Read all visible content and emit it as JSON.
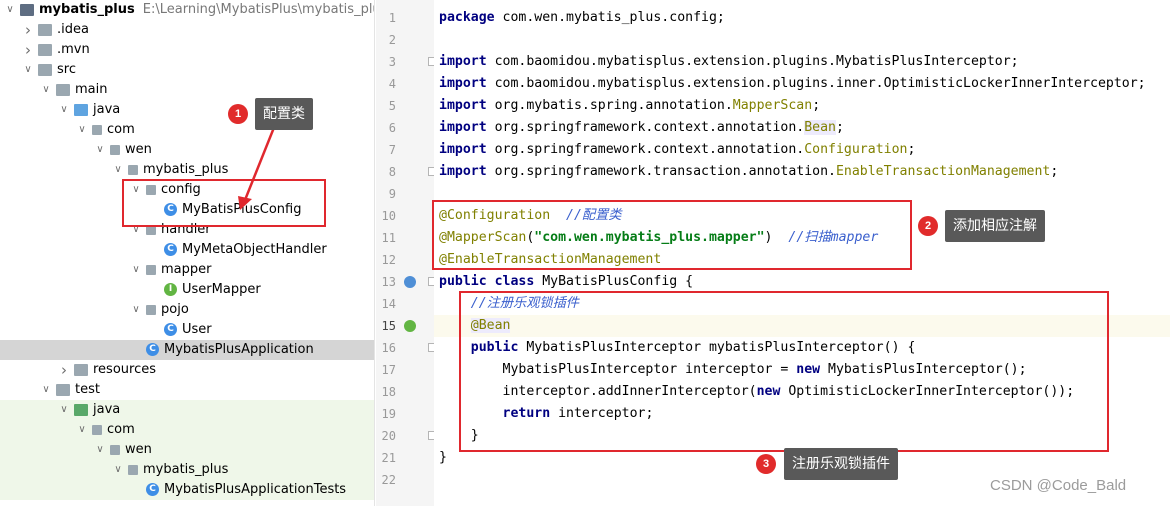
{
  "tree": [
    {
      "depth": 0,
      "open": true,
      "icon": "module",
      "label": "mybatis_plus",
      "path": "E:\\Learning\\MybatisPlus\\mybatis_plus",
      "bold": true
    },
    {
      "depth": 1,
      "open": false,
      "icon": "folder",
      "label": ".idea"
    },
    {
      "depth": 1,
      "open": false,
      "icon": "folder",
      "label": ".mvn"
    },
    {
      "depth": 1,
      "open": true,
      "icon": "folder",
      "label": "src"
    },
    {
      "depth": 2,
      "open": true,
      "icon": "folder",
      "label": "main"
    },
    {
      "depth": 3,
      "open": true,
      "icon": "folder-blue",
      "label": "java"
    },
    {
      "depth": 4,
      "open": true,
      "icon": "package",
      "label": "com"
    },
    {
      "depth": 5,
      "open": true,
      "icon": "package",
      "label": "wen"
    },
    {
      "depth": 6,
      "open": true,
      "icon": "package",
      "label": "mybatis_plus"
    },
    {
      "depth": 7,
      "open": true,
      "icon": "package",
      "label": "config"
    },
    {
      "depth": 8,
      "open": null,
      "icon": "class",
      "label": "MyBatisPlusConfig"
    },
    {
      "depth": 7,
      "open": true,
      "icon": "package",
      "label": "handler"
    },
    {
      "depth": 8,
      "open": null,
      "icon": "class",
      "label": "MyMetaObjectHandler"
    },
    {
      "depth": 7,
      "open": true,
      "icon": "package",
      "label": "mapper"
    },
    {
      "depth": 8,
      "open": null,
      "icon": "interface",
      "label": "UserMapper"
    },
    {
      "depth": 7,
      "open": true,
      "icon": "package",
      "label": "pojo"
    },
    {
      "depth": 8,
      "open": null,
      "icon": "class",
      "label": "User"
    },
    {
      "depth": 7,
      "open": null,
      "icon": "class",
      "label": "MybatisPlusApplication",
      "selected": true
    },
    {
      "depth": 3,
      "open": false,
      "icon": "folder",
      "label": "resources"
    },
    {
      "depth": 2,
      "open": true,
      "icon": "folder",
      "label": "test"
    },
    {
      "depth": 3,
      "open": true,
      "icon": "folder-green",
      "label": "java",
      "test": true
    },
    {
      "depth": 4,
      "open": true,
      "icon": "package",
      "label": "com",
      "test": true
    },
    {
      "depth": 5,
      "open": true,
      "icon": "package",
      "label": "wen",
      "test": true
    },
    {
      "depth": 6,
      "open": true,
      "icon": "package",
      "label": "mybatis_plus",
      "test": true
    },
    {
      "depth": 7,
      "open": null,
      "icon": "class",
      "label": "MybatisPlusApplicationTests",
      "test": true
    }
  ],
  "icon_letters": {
    "class": "C",
    "interface": "I"
  },
  "gutter": {
    "line_numbers": [
      "1",
      "2",
      "3",
      "4",
      "5",
      "6",
      "7",
      "8",
      "9",
      "10",
      "11",
      "12",
      "13",
      "14",
      "15",
      "16",
      "17",
      "18",
      "19",
      "20",
      "21",
      "22"
    ],
    "current_line": "15"
  },
  "code": [
    [
      {
        "t": "package",
        "c": "kw"
      },
      {
        "t": " com.wen.mybatis_plus.config;",
        "c": "pl"
      }
    ],
    [],
    [
      {
        "t": "import",
        "c": "kw"
      },
      {
        "t": " com.baomidou.mybatisplus.extension.plugins.MybatisPlusInterceptor;",
        "c": "pl"
      }
    ],
    [
      {
        "t": "import",
        "c": "kw"
      },
      {
        "t": " com.baomidou.mybatisplus.extension.plugins.inner.OptimisticLockerInnerInterceptor;",
        "c": "pl"
      }
    ],
    [
      {
        "t": "import",
        "c": "kw"
      },
      {
        "t": " org.mybatis.spring.annotation.",
        "c": "pl"
      },
      {
        "t": "MapperScan",
        "c": "ann"
      },
      {
        "t": ";",
        "c": "pl"
      }
    ],
    [
      {
        "t": "import",
        "c": "kw"
      },
      {
        "t": " org.springframework.context.annotation.",
        "c": "pl"
      },
      {
        "t": "Bean",
        "c": "ann hl"
      },
      {
        "t": ";",
        "c": "pl"
      }
    ],
    [
      {
        "t": "import",
        "c": "kw"
      },
      {
        "t": " org.springframework.context.annotation.",
        "c": "pl"
      },
      {
        "t": "Configuration",
        "c": "ann"
      },
      {
        "t": ";",
        "c": "pl"
      }
    ],
    [
      {
        "t": "import",
        "c": "kw"
      },
      {
        "t": " org.springframework.transaction.annotation.",
        "c": "pl"
      },
      {
        "t": "EnableTransactionManagement",
        "c": "ann"
      },
      {
        "t": ";",
        "c": "pl"
      }
    ],
    [],
    [
      {
        "t": "@Configuration",
        "c": "ann"
      },
      {
        "t": "  ",
        "c": "pl"
      },
      {
        "t": "//配置类",
        "c": "cmt"
      }
    ],
    [
      {
        "t": "@MapperScan",
        "c": "ann"
      },
      {
        "t": "(",
        "c": "pl"
      },
      {
        "t": "\"com.wen.mybatis_plus.mapper\"",
        "c": "str"
      },
      {
        "t": ")  ",
        "c": "pl"
      },
      {
        "t": "//扫描mapper",
        "c": "cmt"
      }
    ],
    [
      {
        "t": "@EnableTransactionManagement",
        "c": "ann"
      }
    ],
    [
      {
        "t": "public class",
        "c": "kw"
      },
      {
        "t": " MyBatisPlusConfig {",
        "c": "pl"
      }
    ],
    [
      {
        "t": "    ",
        "c": "pl"
      },
      {
        "t": "//注册乐观锁插件",
        "c": "cmt"
      }
    ],
    [
      {
        "t": "    ",
        "c": "pl"
      },
      {
        "t": "@Bean",
        "c": "ann hl"
      }
    ],
    [
      {
        "t": "    ",
        "c": "pl"
      },
      {
        "t": "public",
        "c": "kw"
      },
      {
        "t": " MybatisPlusInterceptor mybatisPlusInterceptor() {",
        "c": "pl"
      }
    ],
    [
      {
        "t": "        MybatisPlusInterceptor interceptor = ",
        "c": "pl"
      },
      {
        "t": "new",
        "c": "kw"
      },
      {
        "t": " MybatisPlusInterceptor();",
        "c": "pl"
      }
    ],
    [
      {
        "t": "        interceptor.addInnerInterceptor(",
        "c": "pl"
      },
      {
        "t": "new",
        "c": "kw"
      },
      {
        "t": " OptimisticLockerInnerInterceptor());",
        "c": "pl"
      }
    ],
    [
      {
        "t": "        ",
        "c": "pl"
      },
      {
        "t": "return",
        "c": "kw"
      },
      {
        "t": " interceptor;",
        "c": "pl"
      }
    ],
    [
      {
        "t": "    }",
        "c": "pl"
      }
    ],
    [
      {
        "t": "}",
        "c": "pl"
      }
    ],
    []
  ],
  "callouts": [
    {
      "num": "1",
      "text": "配置类"
    },
    {
      "num": "2",
      "text": "添加相应注解"
    },
    {
      "num": "3",
      "text": "注册乐观锁插件"
    }
  ],
  "watermark": "CSDN @Code_Bald",
  "colors": {
    "annotation_red": "#e0282e",
    "badge_red": "#e12b2b",
    "tag_bg": "#595959"
  }
}
